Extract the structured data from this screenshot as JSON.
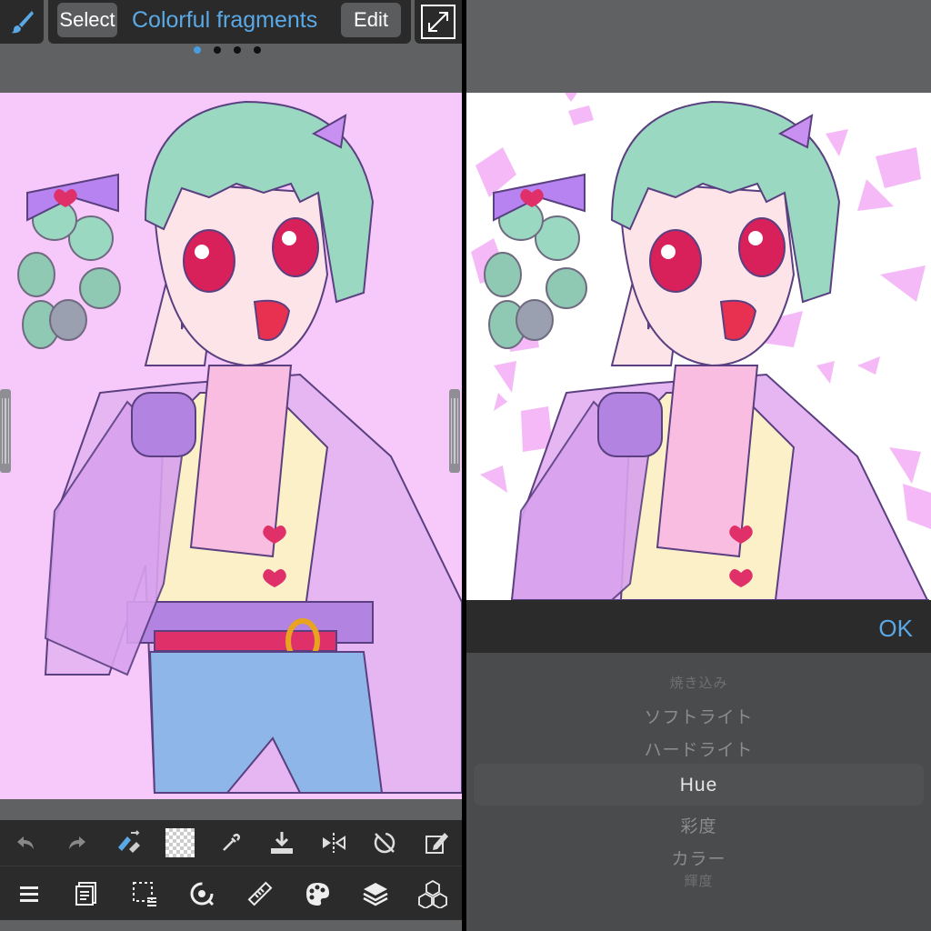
{
  "header": {
    "select_label": "Select",
    "brush_name": "Colorful fragments",
    "edit_label": "Edit",
    "page_dots": 4,
    "active_page": 1
  },
  "toolbar": {
    "icons": [
      "undo-icon",
      "redo-icon",
      "pen-eraser-icon",
      "color-swatch",
      "eyedropper-icon",
      "download-icon",
      "flip-icon",
      "rotate-lock-icon",
      "edit-box-icon"
    ]
  },
  "menubar": {
    "icons": [
      "menu-icon",
      "document-icon",
      "selection-icon",
      "transform-icon",
      "ruler-icon",
      "palette-icon",
      "layers-icon",
      "materials-icon"
    ]
  },
  "blend_panel": {
    "ok_label": "OK",
    "options": [
      {
        "label": "焼き込み",
        "state": "faded"
      },
      {
        "label": "ソフトライト",
        "state": "normal"
      },
      {
        "label": "ハードライト",
        "state": "normal"
      },
      {
        "label": "Hue",
        "state": "selected"
      },
      {
        "label": "彩度",
        "state": "normal"
      },
      {
        "label": "カラー",
        "state": "normal"
      },
      {
        "label": "輝度",
        "state": "faded"
      }
    ]
  },
  "colors": {
    "accent": "#5aa9e6",
    "canvas_left_bg": "#f7c9fb",
    "canvas_right_bg": "#ffffff",
    "panel_bg": "#5f6163",
    "bar_bg": "#2b2b2b"
  }
}
